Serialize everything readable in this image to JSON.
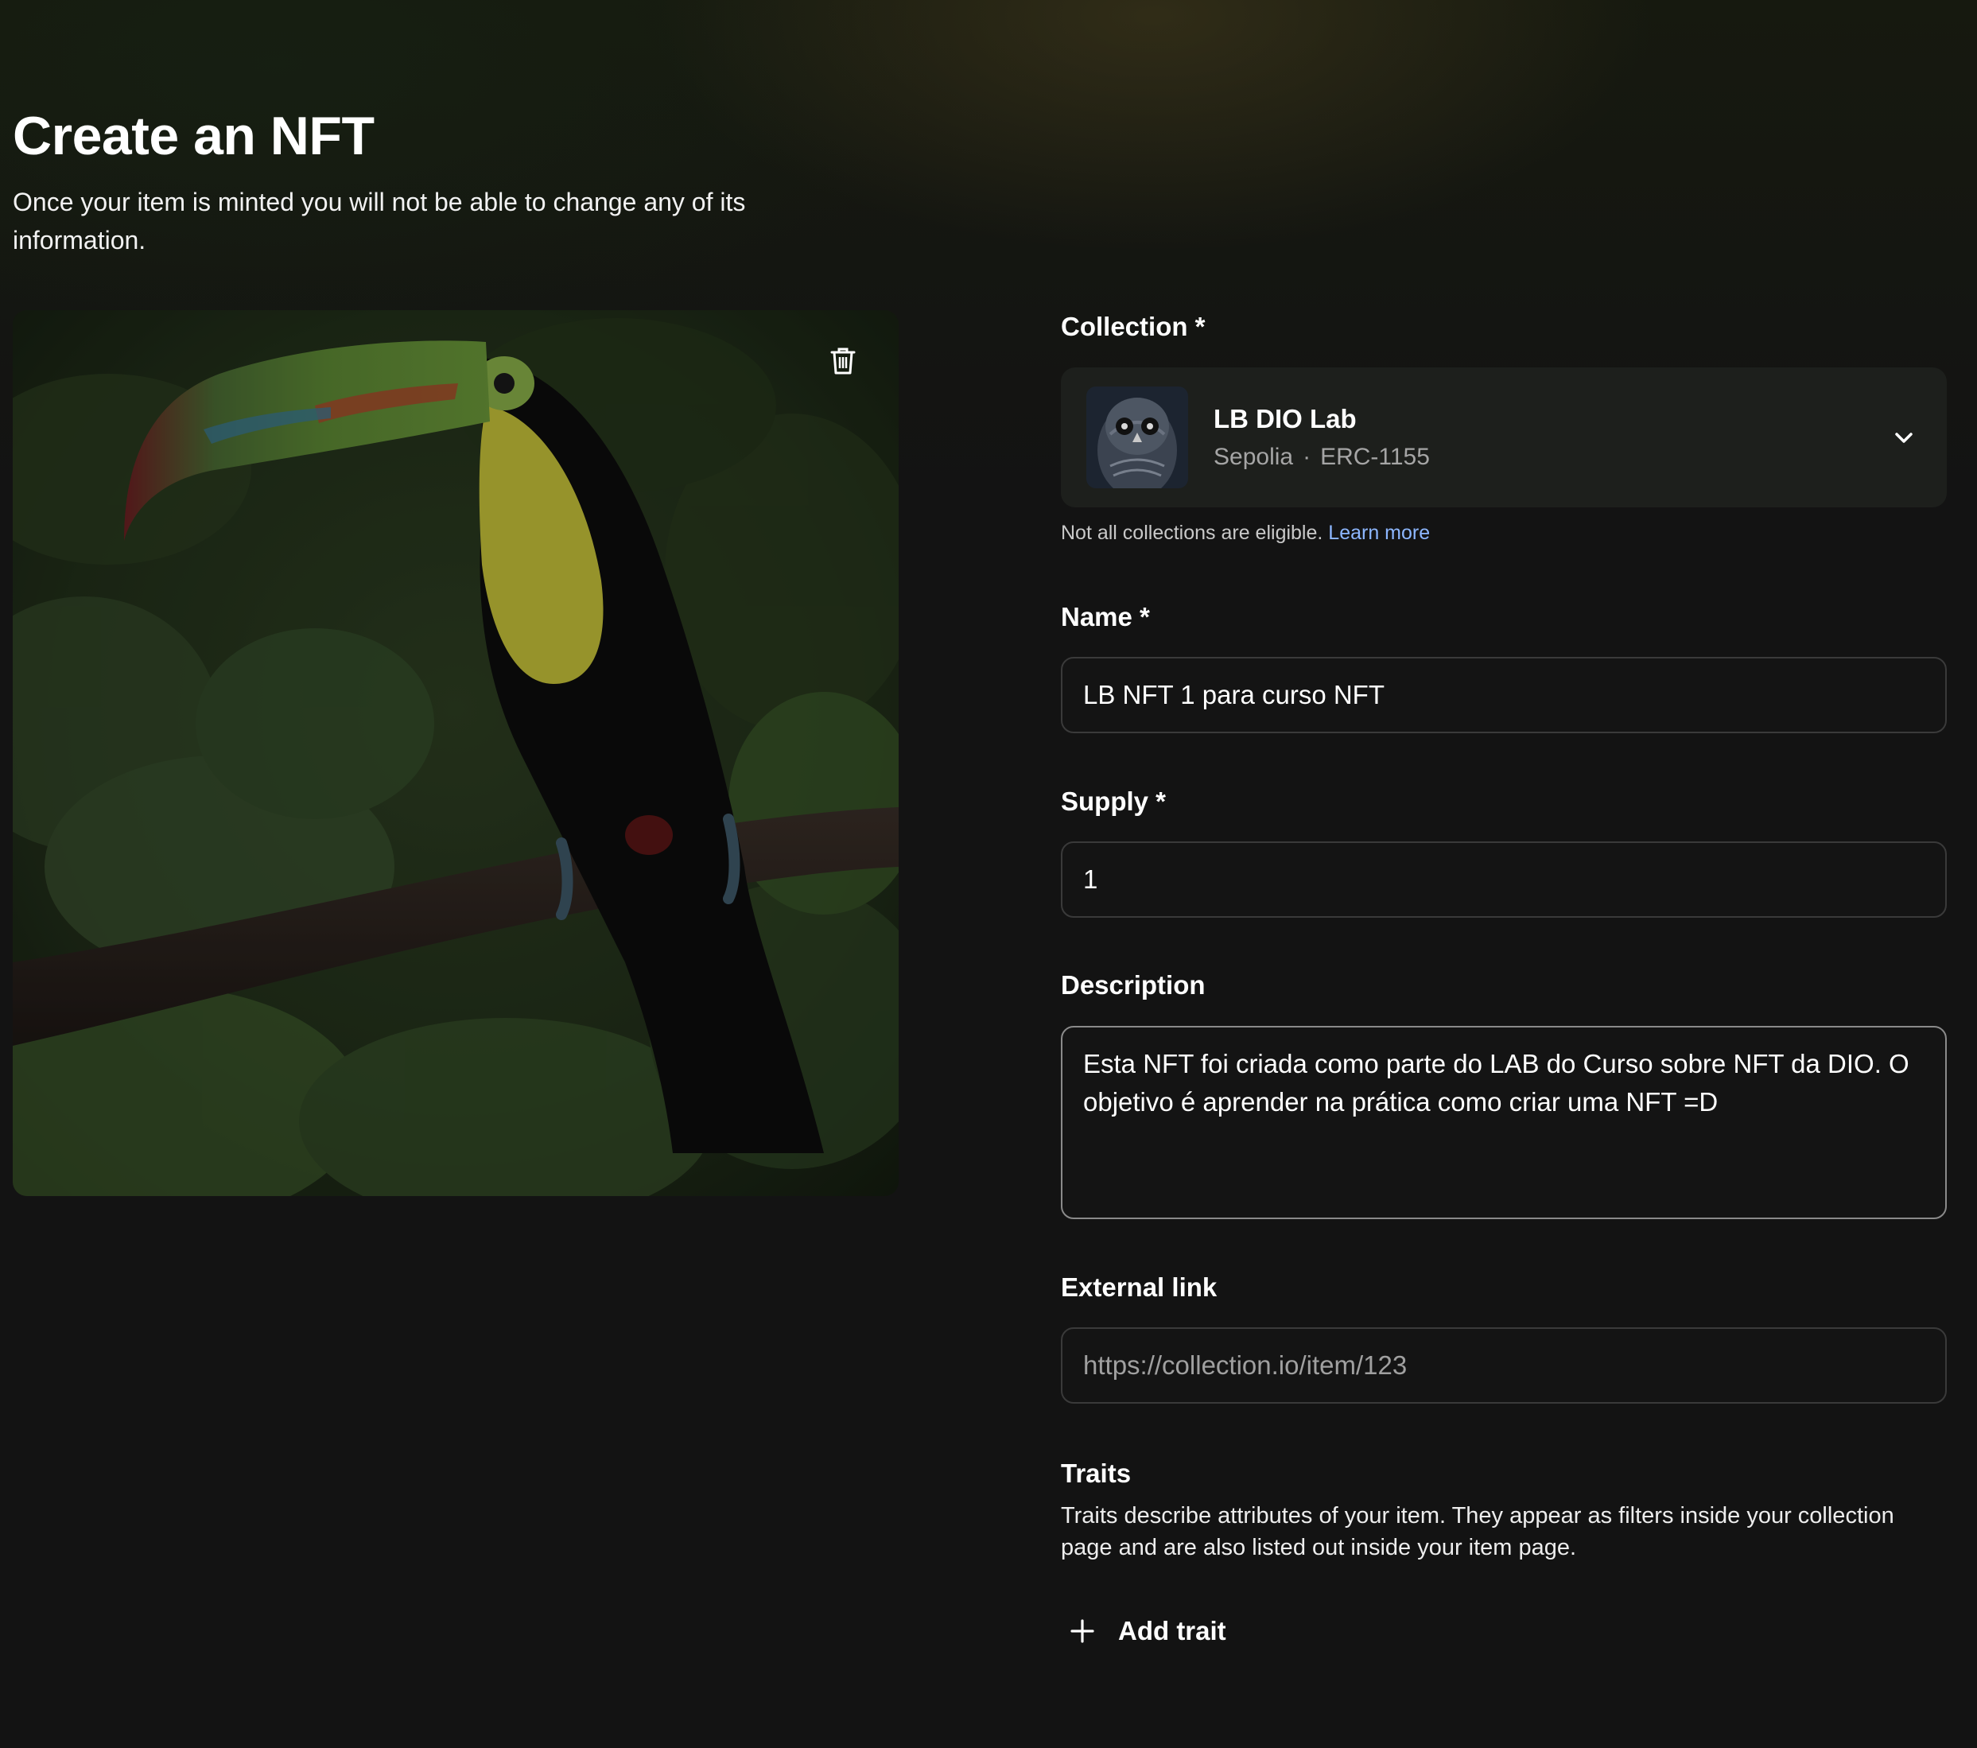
{
  "header": {
    "title": "Create an NFT",
    "subtitle": "Once your item is minted you will not be able to change any of its information."
  },
  "media": {
    "alt": "Keel-billed toucan perched on a branch",
    "delete_icon": "trash-icon"
  },
  "form": {
    "collection": {
      "label": "Collection *",
      "selected_name": "LB DIO Lab",
      "network": "Sepolia",
      "separator": "·",
      "standard": "ERC-1155",
      "avatar_icon": "owl-avatar",
      "dropdown_icon": "chevron-down-icon",
      "helper_text": "Not all collections are eligible.",
      "helper_link": "Learn more"
    },
    "name": {
      "label": "Name *",
      "value": "LB NFT 1 para curso NFT"
    },
    "supply": {
      "label": "Supply *",
      "value": "1"
    },
    "description": {
      "label": "Description",
      "value": "Esta NFT foi criada como parte do LAB do Curso sobre NFT da DIO. O objetivo é aprender na prática como criar uma NFT =D"
    },
    "external_link": {
      "label": "External link",
      "placeholder": "https://collection.io/item/123"
    },
    "traits": {
      "label": "Traits",
      "description": "Traits describe attributes of your item. They appear as filters inside your collection page and are also listed out inside your item page.",
      "add_label": "Add trait",
      "add_icon": "plus-icon"
    }
  },
  "colors": {
    "background": "#131313",
    "input_border": "#3a3a3a",
    "focused_border": "#8a8a8a",
    "link": "#8db7ff",
    "select_bg": "#1d1f1c"
  }
}
